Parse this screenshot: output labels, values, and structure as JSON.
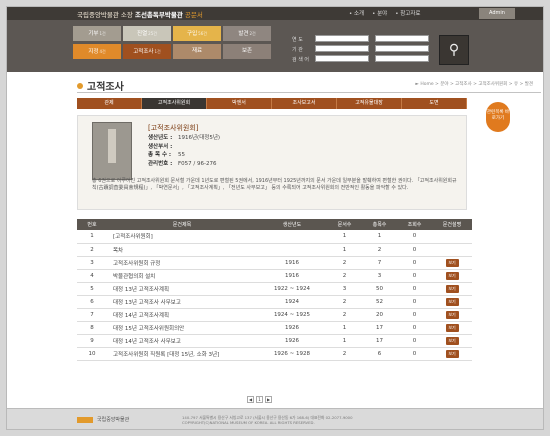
{
  "header": {
    "museum": "국립중앙박물관 소장",
    "collection": "조선총독부박물관",
    "collection_suffix": "공문서",
    "links": [
      "• 소개",
      "• 분야",
      "• 참고자료"
    ],
    "admin_label": "Admin"
  },
  "categories": [
    {
      "label": "기부",
      "count": "1건",
      "color": "#a39c90"
    },
    {
      "label": "진열",
      "count": "25건",
      "color": "#c9c6b9"
    },
    {
      "label": "구입",
      "count": "56건",
      "color": "#e5b44a"
    },
    {
      "label": "발견",
      "count": "2건",
      "color": "#8f8680"
    },
    {
      "label": "지정",
      "count": "4건",
      "color": "#e08a2a"
    },
    {
      "label": "고적조사",
      "count": "1건",
      "color": "#a0501f"
    },
    {
      "label": "재료",
      "count": "",
      "color": "#ad8a6a"
    },
    {
      "label": "보존",
      "count": "",
      "color": "#8c8078"
    }
  ],
  "search": {
    "labels": [
      "연 도",
      "기 관",
      "검 색 어"
    ]
  },
  "page": {
    "title": "고적조사",
    "breadcrumb": "► Home > 분야 > 고적조사 > 고적조사위원회 > 유 > 발견"
  },
  "tabs": [
    "관제",
    "고적조사위원회",
    "박엔서",
    "조사보고서",
    "고적유물대장",
    "도면"
  ],
  "side_button": "관련목록 바로가기",
  "info": {
    "title": "[고적조사위원회]",
    "fields": [
      {
        "label": "생산년도 :",
        "value": "1916년(대정5년)"
      },
      {
        "label": "생산부서 :",
        "value": ""
      },
      {
        "label": "총 목 수 :",
        "value": "55"
      },
      {
        "label": "관리번호 :",
        "value": "F057 / 96-276"
      }
    ],
    "description": "총 6권으로 이루어진 고적조사위원회 문서철 가운데 1년도로 편철된 5권에서, 1916년부터 1925년까지의 문서 가운데 일부분을 발췌하여 편철한 권이다. 「고적조사위원회규칙(古蹟調査委員會規程)」, 「박연문서」, 「고적조사계획」, 「전년도 사무보고」 등의 수록되어 고적조사위원회의 전반적인 활동을 파악할 수 있다."
  },
  "table": {
    "headers": [
      "번호",
      "문건제목",
      "생산년도",
      "문서수",
      "총목수",
      "조회수",
      "문건설명"
    ],
    "rows": [
      [
        "1",
        "[고적조사위원회]",
        "",
        "1",
        "1",
        "0",
        ""
      ],
      [
        "2",
        "목차",
        "",
        "1",
        "2",
        "0",
        ""
      ],
      [
        "3",
        "고적조사위원회 규정",
        "1916",
        "2",
        "7",
        "0",
        "보기"
      ],
      [
        "4",
        "박물관협의회 설치",
        "1916",
        "2",
        "3",
        "0",
        "보기"
      ],
      [
        "5",
        "대정 13년 고적조사계획",
        "1922 ~ 1924",
        "3",
        "50",
        "0",
        "보기"
      ],
      [
        "6",
        "대정 13년 고적조사 사무보고",
        "1924",
        "2",
        "52",
        "0",
        "보기"
      ],
      [
        "7",
        "대정 14년 고적조사계획",
        "1924 ~ 1925",
        "2",
        "20",
        "0",
        "보기"
      ],
      [
        "8",
        "대정 15년 고적조사위원회의안",
        "1926",
        "1",
        "17",
        "0",
        "보기"
      ],
      [
        "9",
        "대정 14년 고적조사 사무보고",
        "1926",
        "1",
        "17",
        "0",
        "보기"
      ],
      [
        "10",
        "고적조사위원회 직원록 [대정 15년, 소화 3년]",
        "1926 ~ 1928",
        "2",
        "6",
        "0",
        "보기"
      ]
    ]
  },
  "pager": [
    "◀",
    "1",
    "▶"
  ],
  "footer": {
    "logo_name": "국립중앙박물관",
    "address": "140-797 서울특별시 용산구 서빙고로 137 (서울시 용산구 용산동 6가 168-6) 대표전화 02-2077-9000",
    "copyright": "COPYRIGHT(C)NATIONAL MUSEUM OF KOREA. ALL RIGHTS RESERVED."
  }
}
